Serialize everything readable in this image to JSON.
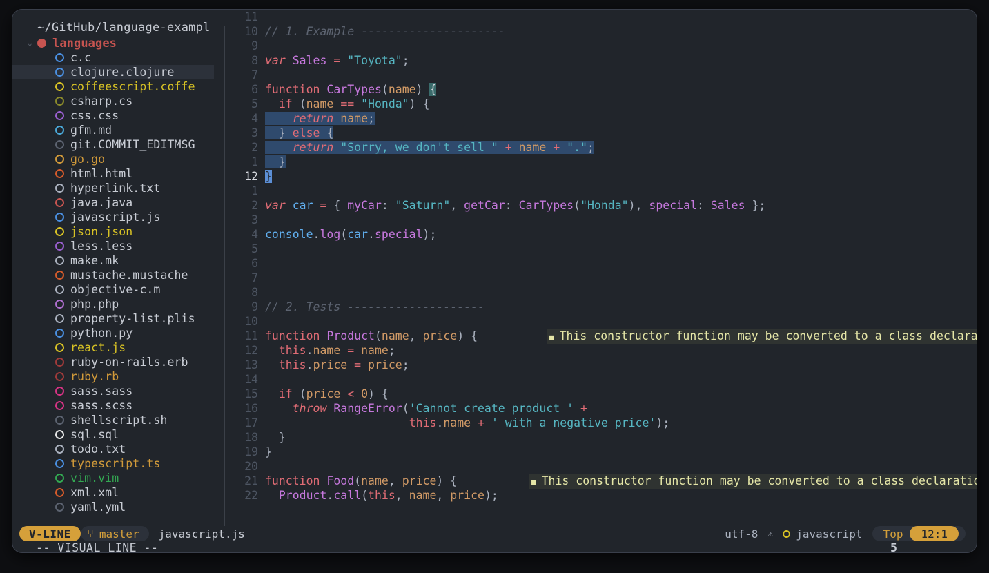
{
  "window": {
    "title": "~/GitHub/language-exampl"
  },
  "sidebar": {
    "root_path": "~/GitHub/language-exampl",
    "folder": {
      "label": "languages",
      "chevron": "⌄",
      "icon": "folder-dot-icon",
      "color": "#c75450"
    },
    "items": [
      {
        "label": "c.c",
        "color": "#4a8fe0"
      },
      {
        "label": "clojure.clojure",
        "color": "#4a8fe0",
        "selected": true
      },
      {
        "label": "coffeescript.coffe",
        "color": "#d8c225"
      },
      {
        "label": "csharp.cs",
        "color": "#8a8a2b"
      },
      {
        "label": "css.css",
        "color": "#9a5fd0"
      },
      {
        "label": "gfm.md",
        "color": "#4aa8d8"
      },
      {
        "label": "git.COMMIT_EDITMSG",
        "color": "#5c6370"
      },
      {
        "label": "go.go",
        "color": "#d19a3a"
      },
      {
        "label": "html.html",
        "color": "#d55b2b"
      },
      {
        "label": "hyperlink.txt",
        "color": "#abb2bf"
      },
      {
        "label": "java.java",
        "color": "#c75450"
      },
      {
        "label": "javascript.js",
        "color": "#4a8fe0"
      },
      {
        "label": "json.json",
        "color": "#d8c225"
      },
      {
        "label": "less.less",
        "color": "#9a5fd0"
      },
      {
        "label": "make.mk",
        "color": "#abb2bf"
      },
      {
        "label": "mustache.mustache",
        "color": "#d55b2b"
      },
      {
        "label": "objective-c.m",
        "color": "#abb2bf"
      },
      {
        "label": "php.php",
        "color": "#b06fd0"
      },
      {
        "label": "property-list.plis",
        "color": "#abb2bf"
      },
      {
        "label": "python.py",
        "color": "#4a8fe0"
      },
      {
        "label": "react.js",
        "color": "#d8c225"
      },
      {
        "label": "ruby-on-rails.erb",
        "color": "#a03a3a"
      },
      {
        "label": "ruby.rb",
        "color": "#a03a3a"
      },
      {
        "label": "sass.sass",
        "color": "#d63384"
      },
      {
        "label": "sass.scss",
        "color": "#d63384"
      },
      {
        "label": "shellscript.sh",
        "color": "#5c6370"
      },
      {
        "label": "sql.sql",
        "color": "#e6e6e6"
      },
      {
        "label": "todo.txt",
        "color": "#abb2bf"
      },
      {
        "label": "typescript.ts",
        "color": "#4a8fe0"
      },
      {
        "label": "vim.vim",
        "color": "#33a852"
      },
      {
        "label": "xml.xml",
        "color": "#d55b2b"
      },
      {
        "label": "yaml.yml",
        "color": "#5c6370"
      }
    ]
  },
  "editor": {
    "filename": "javascript.js",
    "lines": [
      {
        "num": "11",
        "text": ""
      },
      {
        "num": "10",
        "text": "// 1. Example ---------------------"
      },
      {
        "num": "9",
        "text": ""
      },
      {
        "num": "8",
        "text": "var Sales = \"Toyota\";"
      },
      {
        "num": "7",
        "text": ""
      },
      {
        "num": "6",
        "text": "function CarTypes(name) {"
      },
      {
        "num": "5",
        "text": "  if (name == \"Honda\") {"
      },
      {
        "num": "4",
        "text": "    return name;"
      },
      {
        "num": "3",
        "text": "  } else {"
      },
      {
        "num": "2",
        "text": "    return \"Sorry, we don't sell \" + name + \".\";"
      },
      {
        "num": "1",
        "text": "  }"
      },
      {
        "num": "12",
        "text": "}",
        "current": true
      },
      {
        "num": "1",
        "text": ""
      },
      {
        "num": "2",
        "text": "var car = { myCar: \"Saturn\", getCar: CarTypes(\"Honda\"), special: Sales };"
      },
      {
        "num": "3",
        "text": ""
      },
      {
        "num": "4",
        "text": "console.log(car.special);"
      },
      {
        "num": "5",
        "text": ""
      },
      {
        "num": "6",
        "text": ""
      },
      {
        "num": "7",
        "text": ""
      },
      {
        "num": "8",
        "text": ""
      },
      {
        "num": "9",
        "text": "// 2. Tests --------------------"
      },
      {
        "num": "10",
        "text": ""
      },
      {
        "num": "11",
        "text": "function Product(name, price) {"
      },
      {
        "num": "12",
        "text": "  this.name = name;"
      },
      {
        "num": "13",
        "text": "  this.price = price;"
      },
      {
        "num": "14",
        "text": ""
      },
      {
        "num": "15",
        "text": "  if (price < 0) {"
      },
      {
        "num": "16",
        "text": "    throw RangeError('Cannot create product ' +"
      },
      {
        "num": "17",
        "text": "                     this.name + ' with a negative price');"
      },
      {
        "num": "18",
        "text": "  }"
      },
      {
        "num": "19",
        "text": "}"
      },
      {
        "num": "20",
        "text": ""
      },
      {
        "num": "21",
        "text": "function Food(name, price) {"
      },
      {
        "num": "22",
        "text": "  Product.call(this, name, price);"
      }
    ],
    "diagnostics": [
      {
        "on_line": "11",
        "marker": "■",
        "text": "This constructor function may be converted to a class declaration"
      },
      {
        "on_line": "21",
        "marker": "■",
        "text": "This constructor function may be converted to a class declaration."
      }
    ]
  },
  "statusbar": {
    "mode": "V-LINE",
    "branch_icon": "git-branch-icon",
    "branch": "master",
    "filename": "javascript.js",
    "encoding": "utf-8",
    "warning_icon": "warning-icon",
    "language_dot_color": "#d8c225",
    "language": "javascript",
    "scroll_position": "Top",
    "cursor_position": "12:1",
    "cursor_position_overflow": "5",
    "accent": "#d5a03a"
  },
  "message_line": {
    "text": "-- VISUAL LINE --"
  }
}
